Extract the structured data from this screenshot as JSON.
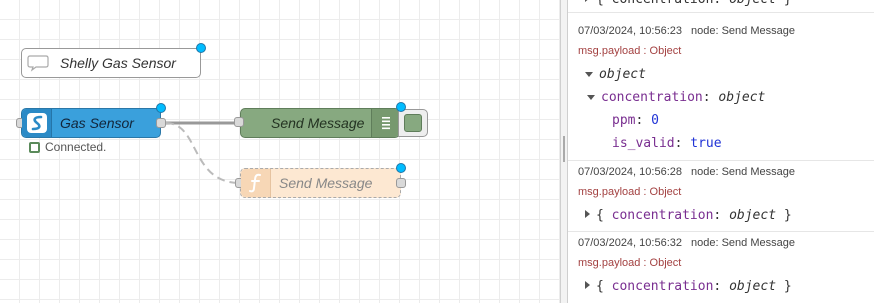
{
  "flow": {
    "comment": {
      "label": "Shelly Gas Sensor",
      "icon": "comment-bubble-icon"
    },
    "gas_sensor": {
      "label": "Gas Sensor",
      "icon": "shelly-logo-icon",
      "status": "Connected.",
      "status_color": "#5a8a5a",
      "color": "#3aa0dc"
    },
    "debug": {
      "label": "Send Message",
      "icon": "debug-list-icon",
      "color": "#87a980"
    },
    "function": {
      "label": "Send Message",
      "icon": "function-icon",
      "disabled": true,
      "color": "#fde8d2"
    },
    "changed_indicator_color": "#00bcff"
  },
  "sidebar": {
    "top_partial": {
      "text": "concentration",
      "sep": ":",
      "type": "object"
    },
    "messages": [
      {
        "timestamp": "07/03/2024, 10:56:23",
        "node": "node: Send Message",
        "topic": "msg.payload : Object",
        "root_type": "object",
        "prop_key": "concentration",
        "prop_type": "object",
        "fields": [
          {
            "key": "ppm",
            "value": "0"
          },
          {
            "key": "is_valid",
            "value": "true"
          }
        ]
      },
      {
        "timestamp": "07/03/2024, 10:56:28",
        "node": "node: Send Message",
        "topic": "msg.payload : Object",
        "summary_key": "concentration",
        "summary_type": "object"
      },
      {
        "timestamp": "07/03/2024, 10:56:32",
        "node": "node: Send Message",
        "topic": "msg.payload : Object",
        "summary_key": "concentration",
        "summary_type": "object"
      }
    ]
  }
}
